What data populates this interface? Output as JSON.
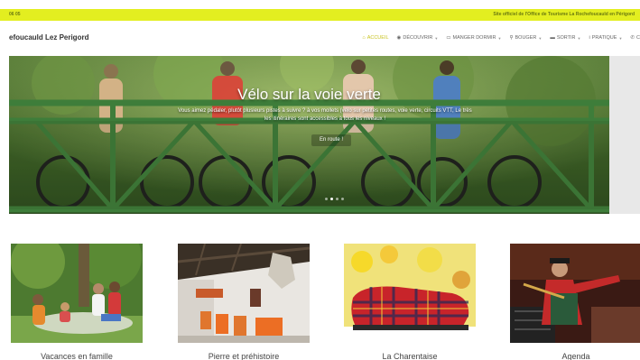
{
  "topbar": {
    "left_text": "06 05",
    "right_text": "Site officiel de l'Office de Tourisme La Rochefoucauld en Périgord"
  },
  "header": {
    "site_title": "efoucauld Lez Perigord",
    "nav": [
      {
        "label": "ACCUEIL",
        "icon": "home-icon",
        "active": true
      },
      {
        "label": "DÉCOUVRIR",
        "icon": "compass-icon",
        "active": false
      },
      {
        "label": "MANGER DORMIR",
        "icon": "bed-icon",
        "active": false
      },
      {
        "label": "BOUGER",
        "icon": "bike-icon",
        "active": false
      },
      {
        "label": "SORTIR",
        "icon": "ticket-icon",
        "active": false
      },
      {
        "label": "PRATIQUE",
        "icon": "info-icon",
        "active": false
      },
      {
        "label": "C",
        "icon": "phone-icon",
        "active": false
      }
    ]
  },
  "hero": {
    "title": "Vélo sur la voie verte",
    "subtitle": "Vous aimez pédaler, plutôt plusieurs pistes à suivre ? à vos mollets (vélo sur petites routes, voie verte, circuits VTT, Le très les itinéraires sont accessibles à tous les niveaux !",
    "cta": "En route !",
    "slide_count": 4,
    "active_slide": 2
  },
  "cards": [
    {
      "caption": "Vacances en famille",
      "image": "family-picnic-photo"
    },
    {
      "caption": "Pierre et préhistoire",
      "image": "museum-exhibit-photo"
    },
    {
      "caption": "La Charentaise",
      "image": "tartan-slipper-photo"
    },
    {
      "caption": "Agenda",
      "image": "musician-performance-photo"
    }
  ],
  "colors": {
    "accent": "#e3ee20",
    "nav_active": "#c8c320",
    "bridge_green": "#3e7d3a"
  }
}
